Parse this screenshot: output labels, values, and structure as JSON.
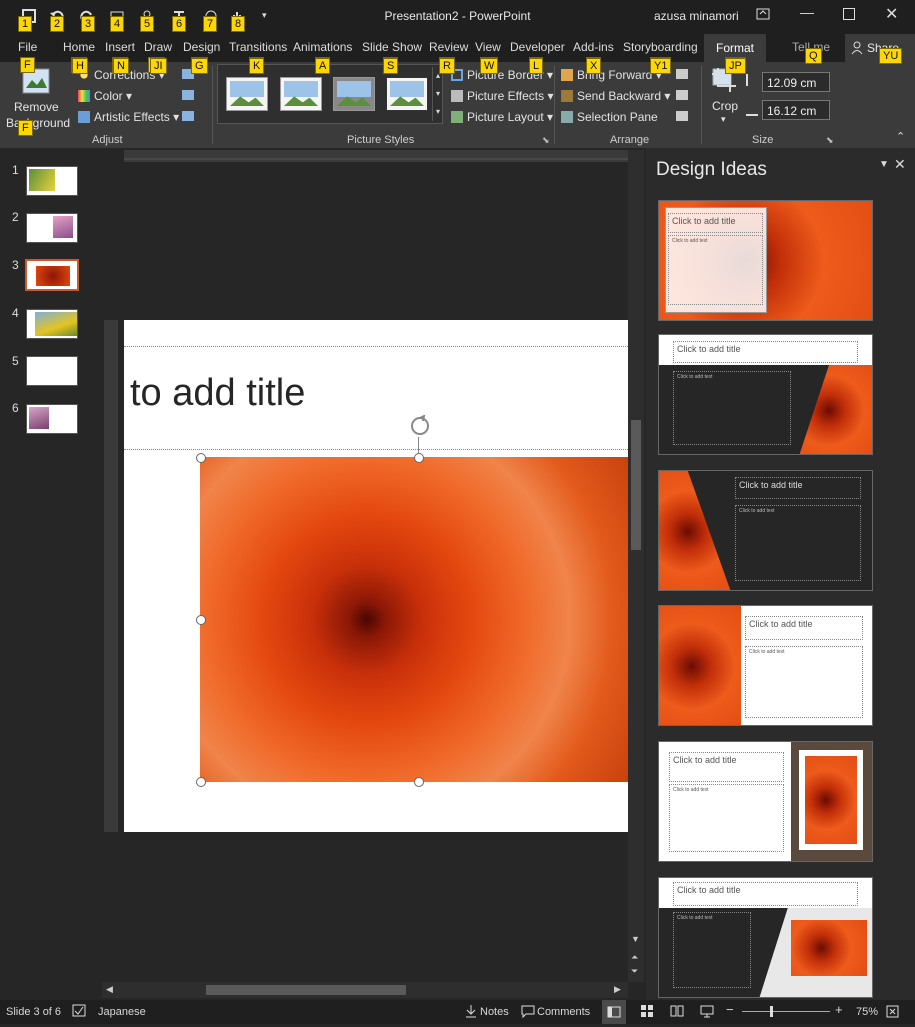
{
  "window": {
    "title": "Presentation2  -  PowerPoint",
    "user": "azusa minamori"
  },
  "quick_access_keytips": [
    "1",
    "2",
    "3",
    "4",
    "5",
    "6",
    "7",
    "8"
  ],
  "tabs": [
    {
      "label": "File",
      "key": "F"
    },
    {
      "label": "Home",
      "key": "H"
    },
    {
      "label": "Insert",
      "key": "N"
    },
    {
      "label": "Draw",
      "key": "JI"
    },
    {
      "label": "Design",
      "key": "G"
    },
    {
      "label": "Transitions",
      "key": "K"
    },
    {
      "label": "Animations",
      "key": "A"
    },
    {
      "label": "Slide Show",
      "key": "S"
    },
    {
      "label": "Review",
      "key": "R"
    },
    {
      "label": "View",
      "key": "W"
    },
    {
      "label": "Developer",
      "key": "L"
    },
    {
      "label": "Add-ins",
      "key": "X"
    },
    {
      "label": "Storyboarding",
      "key": "Y1"
    },
    {
      "label": "Format",
      "key": "JP"
    },
    {
      "label": "Tell me",
      "key": "Q"
    },
    {
      "label": "Share",
      "key": "YU"
    }
  ],
  "ribbon": {
    "adjust": {
      "remove_bg_1": "Remove",
      "remove_bg_2": "Background",
      "corrections": "Corrections",
      "color": "Color",
      "artistic": "Artistic Effects",
      "label": "Adjust"
    },
    "styles": {
      "label": "Picture Styles",
      "border": "Picture Border",
      "effects": "Picture Effects",
      "layout": "Picture Layout"
    },
    "arrange": {
      "bring": "Bring Forward",
      "send": "Send Backward",
      "selection": "Selection Pane",
      "label": "Arrange"
    },
    "size": {
      "crop": "Crop",
      "height": "12.09 cm",
      "width": "16.12 cm",
      "label": "Size"
    }
  },
  "slides": [
    {
      "num": "1"
    },
    {
      "num": "2"
    },
    {
      "num": "3"
    },
    {
      "num": "4"
    },
    {
      "num": "5"
    },
    {
      "num": "6"
    }
  ],
  "slide": {
    "title_text": "to add title"
  },
  "design_ideas": {
    "title": "Design Ideas",
    "title_placeholder": "Click to add title",
    "text_placeholder": "Click to add text"
  },
  "status": {
    "slide_info": "Slide 3 of 6",
    "language": "Japanese",
    "notes": "Notes",
    "comments": "Comments",
    "zoom": "75%"
  },
  "colors": {
    "accent": "#c95a2b",
    "keytip": "#ffd700",
    "ribbon": "#3b3b3b"
  }
}
